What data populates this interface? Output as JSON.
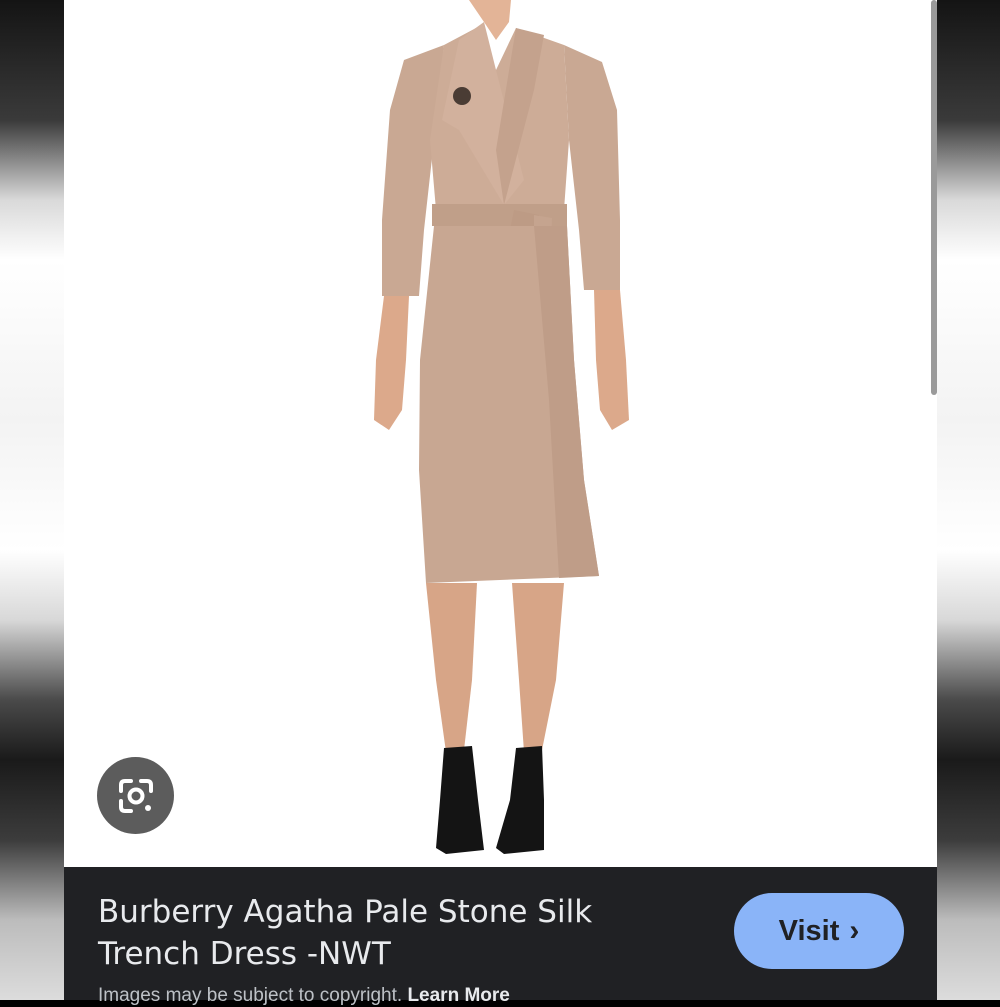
{
  "result": {
    "title": "Burberry Agatha Pale Stone Silk Trench Dress -NWT",
    "visit_label": "Visit",
    "copyright_text": "Images may be subject to copyright.",
    "learn_more_label": "Learn More"
  },
  "icons": {
    "lens": "google-lens-icon",
    "visit_chevron": "chevron-right-icon"
  },
  "colors": {
    "info_bar_bg": "#202124",
    "visit_button_bg": "#8ab4f8",
    "dress": "#c9a893",
    "image_bg": "#ffffff"
  }
}
